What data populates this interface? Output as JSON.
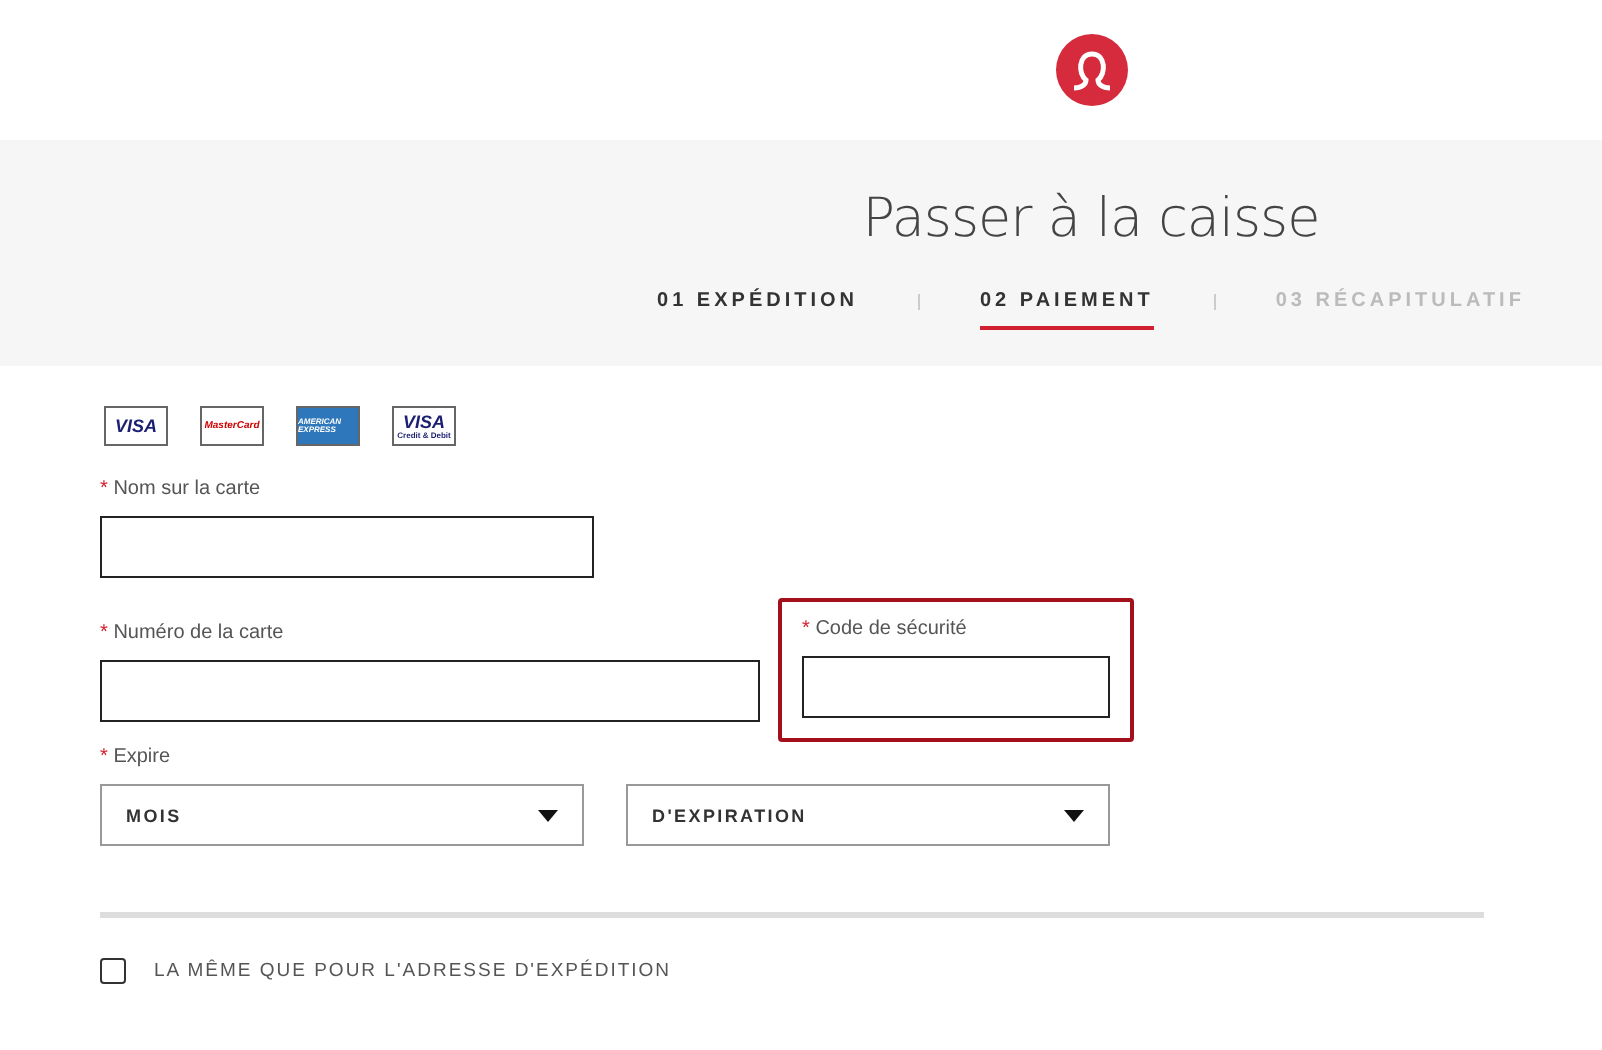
{
  "header": {
    "title": "Passer à la caisse"
  },
  "steps": [
    {
      "label": "01 EXPÉDITION",
      "selected": false,
      "done": true
    },
    {
      "label": "02 PAIEMENT",
      "selected": true,
      "done": false
    },
    {
      "label": "03 RÉCAPITULATIF",
      "selected": false,
      "done": false
    }
  ],
  "cards": [
    {
      "kind": "visa",
      "label": "VISA"
    },
    {
      "kind": "mastercard",
      "label": "MasterCard"
    },
    {
      "kind": "amex",
      "label": "AMERICAN EXPRESS"
    },
    {
      "kind": "visa-debit",
      "label": "VISA",
      "sublabel": "Credit & Debit"
    }
  ],
  "fields": {
    "name": {
      "label": "Nom sur la carte",
      "required_mark": "*"
    },
    "number": {
      "label": "Numéro de la carte",
      "required_mark": "*"
    },
    "security": {
      "label": "Code de sécurité",
      "required_mark": "*",
      "error": true
    }
  },
  "expiry": {
    "label": "Expire",
    "required_mark": "*",
    "month": "MOIS",
    "year": "D'EXPIRATION"
  },
  "same_address": {
    "label": "LA MÊME QUE POUR L'ADRESSE D'EXPÉDITION",
    "checked": false
  }
}
